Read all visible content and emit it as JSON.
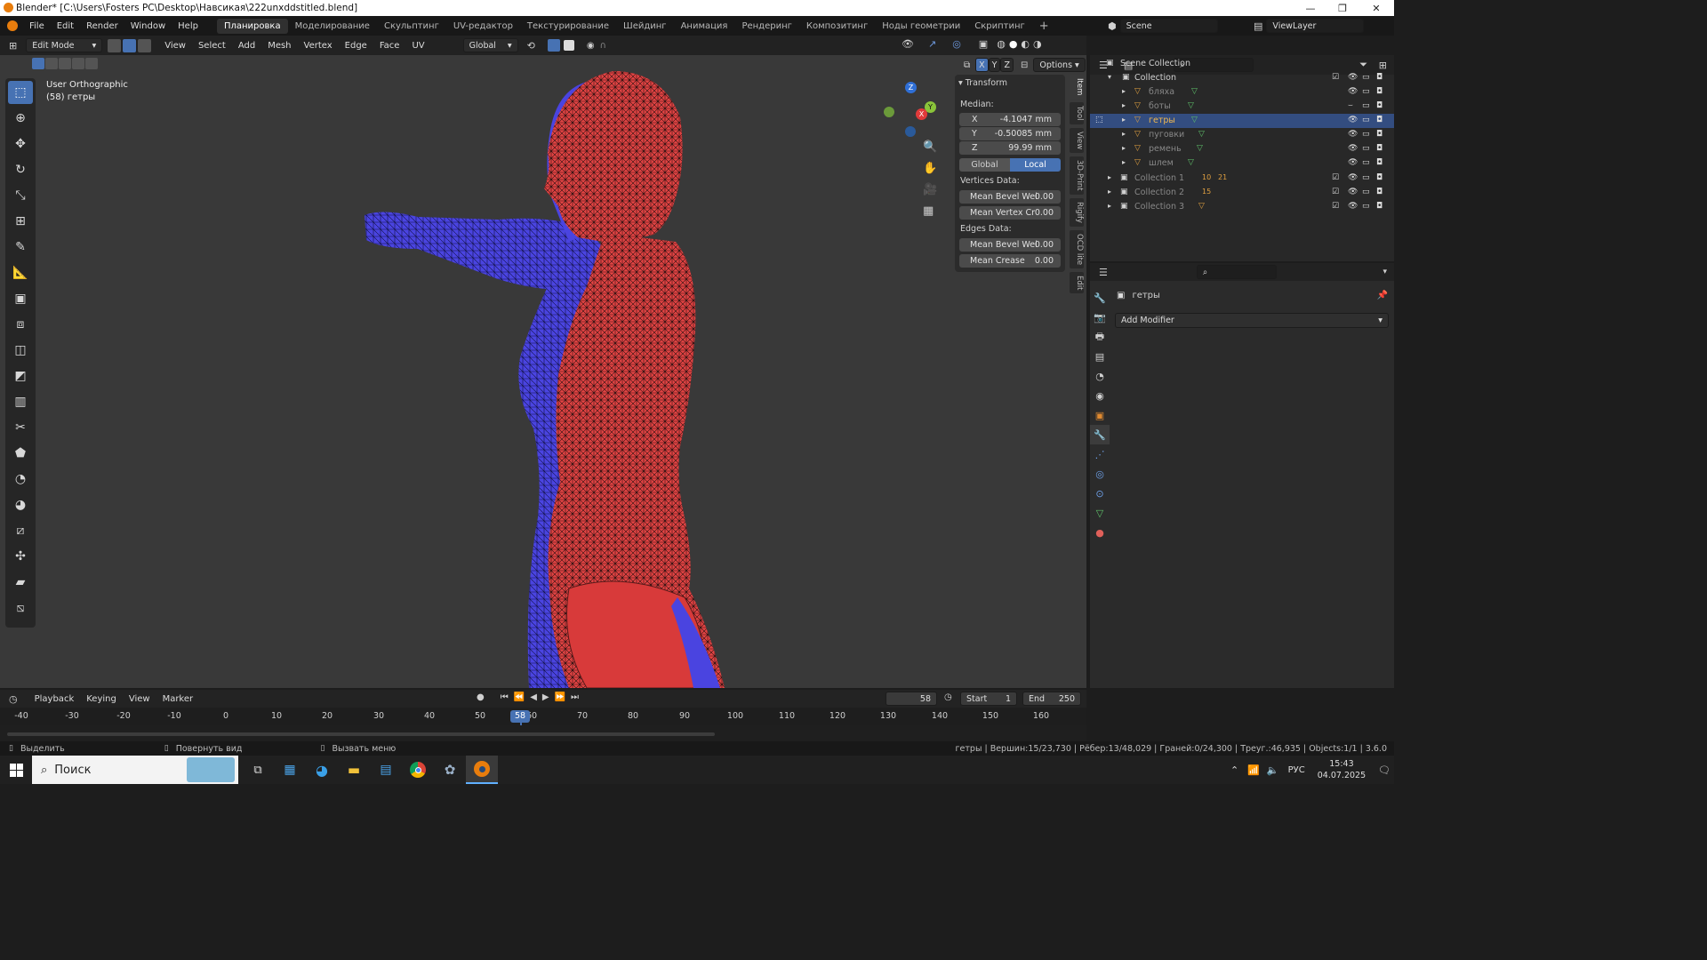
{
  "title": "Blender* [C:\\Users\\Fosters PC\\Desktop\\Навсикая\\222unxddstitled.blend]",
  "menu": [
    "File",
    "Edit",
    "Render",
    "Window",
    "Help"
  ],
  "workspaces": [
    "Планировка",
    "Моделирование",
    "Скульптинг",
    "UV-редактор",
    "Текстурирование",
    "Шейдинг",
    "Анимация",
    "Рендеринг",
    "Композитинг",
    "Ноды геометрии",
    "Скриптинг"
  ],
  "active_workspace": "Планировка",
  "scene": "Scene",
  "viewlayer": "ViewLayer",
  "header": {
    "mode": "Edit Mode",
    "menus": [
      "View",
      "Select",
      "Add",
      "Mesh",
      "Vertex",
      "Edge",
      "Face",
      "UV"
    ],
    "orientation": "Global",
    "options": "Options",
    "axes": [
      "X",
      "Y",
      "Z"
    ]
  },
  "viewport": {
    "view_name": "User Orthographic",
    "object_info": "(58) гетры"
  },
  "gizmo": {
    "x": "X",
    "y": "Y",
    "z": "Z"
  },
  "npanel": {
    "section": "Transform",
    "median": "Median:",
    "fields": [
      {
        "label": "X",
        "value": "-4.1047 mm"
      },
      {
        "label": "Y",
        "value": "-0.50085 mm"
      },
      {
        "label": "Z",
        "value": "99.99 mm"
      }
    ],
    "global": "Global",
    "local": "Local",
    "vertices_data": "Vertices Data:",
    "vfields": [
      {
        "label": "Mean Bevel Wei",
        "value": "0.00"
      },
      {
        "label": "Mean Vertex Cr",
        "value": "0.00"
      }
    ],
    "edges_data": "Edges Data:",
    "efields": [
      {
        "label": "Mean Bevel Wei",
        "value": "0.00"
      },
      {
        "label": "Mean Crease",
        "value": "0.00"
      }
    ]
  },
  "side_tabs": [
    "Item",
    "Tool",
    "View",
    "3D-Print",
    "Rigify",
    "OCD lite",
    "Edit"
  ],
  "outliner": {
    "root": "Scene Collection",
    "collection": "Collection",
    "objects": [
      "бляха",
      "боты",
      "гетры",
      "пуговки",
      "ремень",
      "шлем"
    ],
    "selected": "гетры",
    "sub": [
      {
        "name": "Collection 1",
        "badge1": "10",
        "badge2": "21"
      },
      {
        "name": "Collection 2",
        "badge1": "15",
        "badge2": ""
      },
      {
        "name": "Collection 3",
        "badge1": "",
        "badge2": ""
      }
    ]
  },
  "properties": {
    "object": "гетры",
    "add_modifier": "Add Modifier"
  },
  "timeline": {
    "menus": [
      "Playback",
      "Keying",
      "View",
      "Marker"
    ],
    "current": "58",
    "start_label": "Start",
    "start": "1",
    "end_label": "End",
    "end": "250",
    "ticks": [
      "-40",
      "-30",
      "-20",
      "-10",
      "0",
      "10",
      "20",
      "30",
      "40",
      "50",
      "60",
      "70",
      "80",
      "90",
      "100",
      "110",
      "120",
      "130",
      "140",
      "150",
      "160"
    ]
  },
  "status": {
    "left1": "Выделить",
    "left2": "Повернуть вид",
    "left3": "Вызвать меню",
    "right": "гетры | Вершин:15/23,730 | Рёбер:13/48,029 | Граней:0/24,300 | Треуг.:46,935 | Objects:1/1 | 3.6.0"
  },
  "taskbar": {
    "search": "Поиск",
    "lang": "РУС",
    "time": "15:43",
    "date": "04.07.2025"
  }
}
